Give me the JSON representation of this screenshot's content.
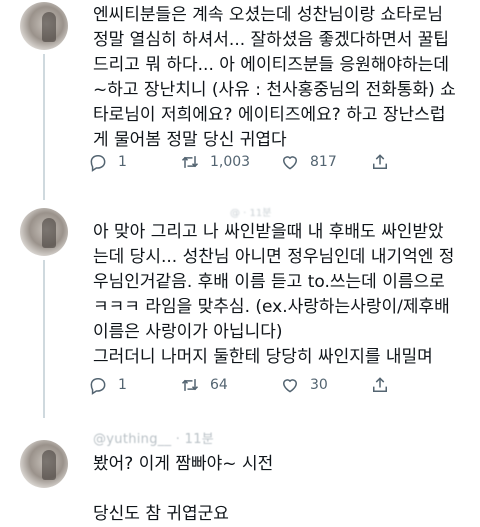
{
  "tweets": [
    {
      "text": "엔씨티분들은 계속 오셨는데 성찬님이랑 쇼타로님\n정말 열심히 하셔서... 잘하셨음 좋겠다하면서 꿀팁\n드리고 뭐 하다... 아 에이티즈분들 응원해야하는데\n~하고 장난치니 (사유 : 천사홍중님의 전화통화) 쇼\n타로님이 저희에요? 에이티즈에요? 하고 장난스럽\n게 물어봄 정말 당신 귀엽다",
      "replies": "1",
      "retweets": "1,003",
      "likes": "817"
    },
    {
      "text": "아 맞아 그리고 나 싸인받을때 내 후배도 싸인받았\n는데 당시... 성찬님 아니면 정우님인데 내기억엔 정\n우님인거같음. 후배 이름 듣고 to.쓰는데 이름으로\nㅋㅋㅋ 라임을 맞추심. (ex.사랑하는사랑이/제후배\n이름은 사랑이가 아닙니다)\n그러더니 나머지 둘한테 당당히 싸인지를 내밀며",
      "replies": "1",
      "retweets": "64",
      "likes": "30"
    },
    {
      "handle": "@yuthing__ · 11분",
      "text": "봤어? 이게 짬빠야~ 시전\n\n당신도 참 귀엽군요"
    }
  ],
  "top_faded": "@ · 11분",
  "icons": {
    "reply": "reply-icon",
    "retweet": "retweet-icon",
    "like": "heart-icon",
    "share": "share-icon"
  },
  "colors": {
    "text": "#0f1419",
    "muted": "#536471",
    "thread_line": "#cfd9de"
  }
}
